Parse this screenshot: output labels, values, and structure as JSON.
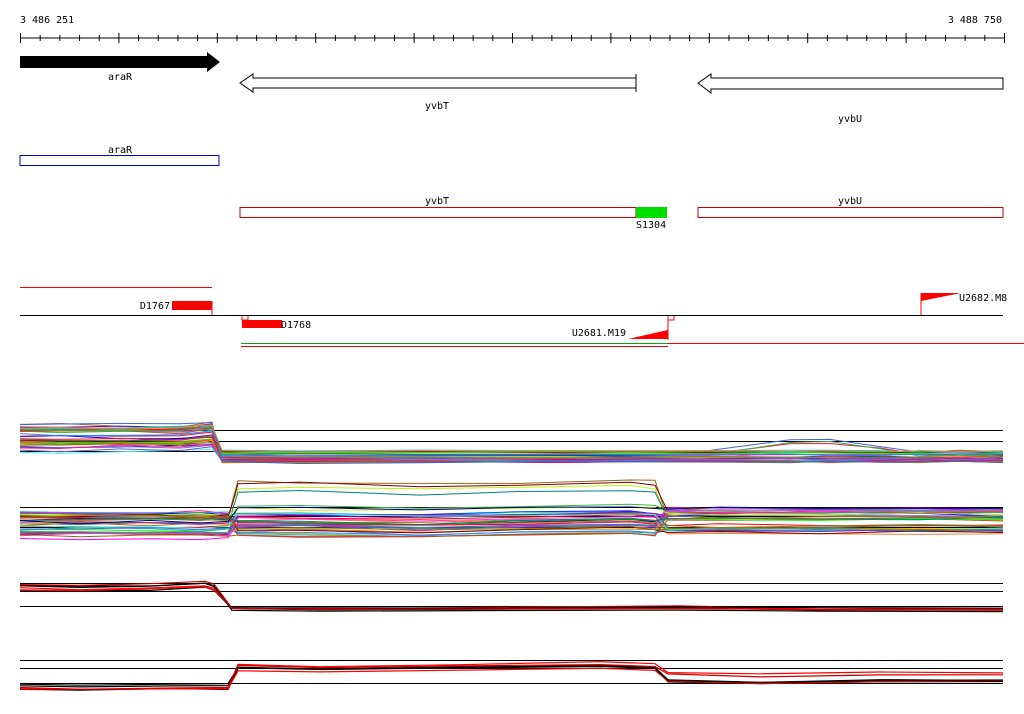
{
  "ruler": {
    "start_label": "3 486 251",
    "end_label": "3 488 750"
  },
  "genes": {
    "araR": "araR",
    "yvbT": "yvbT",
    "yvbU": "yvbU"
  },
  "transcripts": {
    "araR": "araR",
    "yvbT": "yvbT",
    "yvbU": "yvbU",
    "s1304": "S1304"
  },
  "features": {
    "d1767": "D1767",
    "d1768": "D1768",
    "u2681": "U2681.M19",
    "u2682": "U2682.M8"
  },
  "colors": {
    "forward_gene": "#000000",
    "transcript_forward": "#0000cc",
    "transcript_reverse": "#cc0000",
    "segment_marker": "#00dd00",
    "feature": "#ff0000",
    "green_line": "#00aa00"
  },
  "expression_panels": [
    {
      "panel": 1,
      "profile": "high on araR, drop after araR, flat low through yvbT and yvbU"
    },
    {
      "panel": 2,
      "profile": "low on araR, rise at yvbT start, high through yvbT, drop at yvbT end"
    },
    {
      "panel": 3,
      "profile": "high on araR, drop after araR, flat low"
    },
    {
      "panel": 4,
      "profile": "low on araR, rise at yvbT start, high through yvbT, drop at yvbT end"
    }
  ]
}
